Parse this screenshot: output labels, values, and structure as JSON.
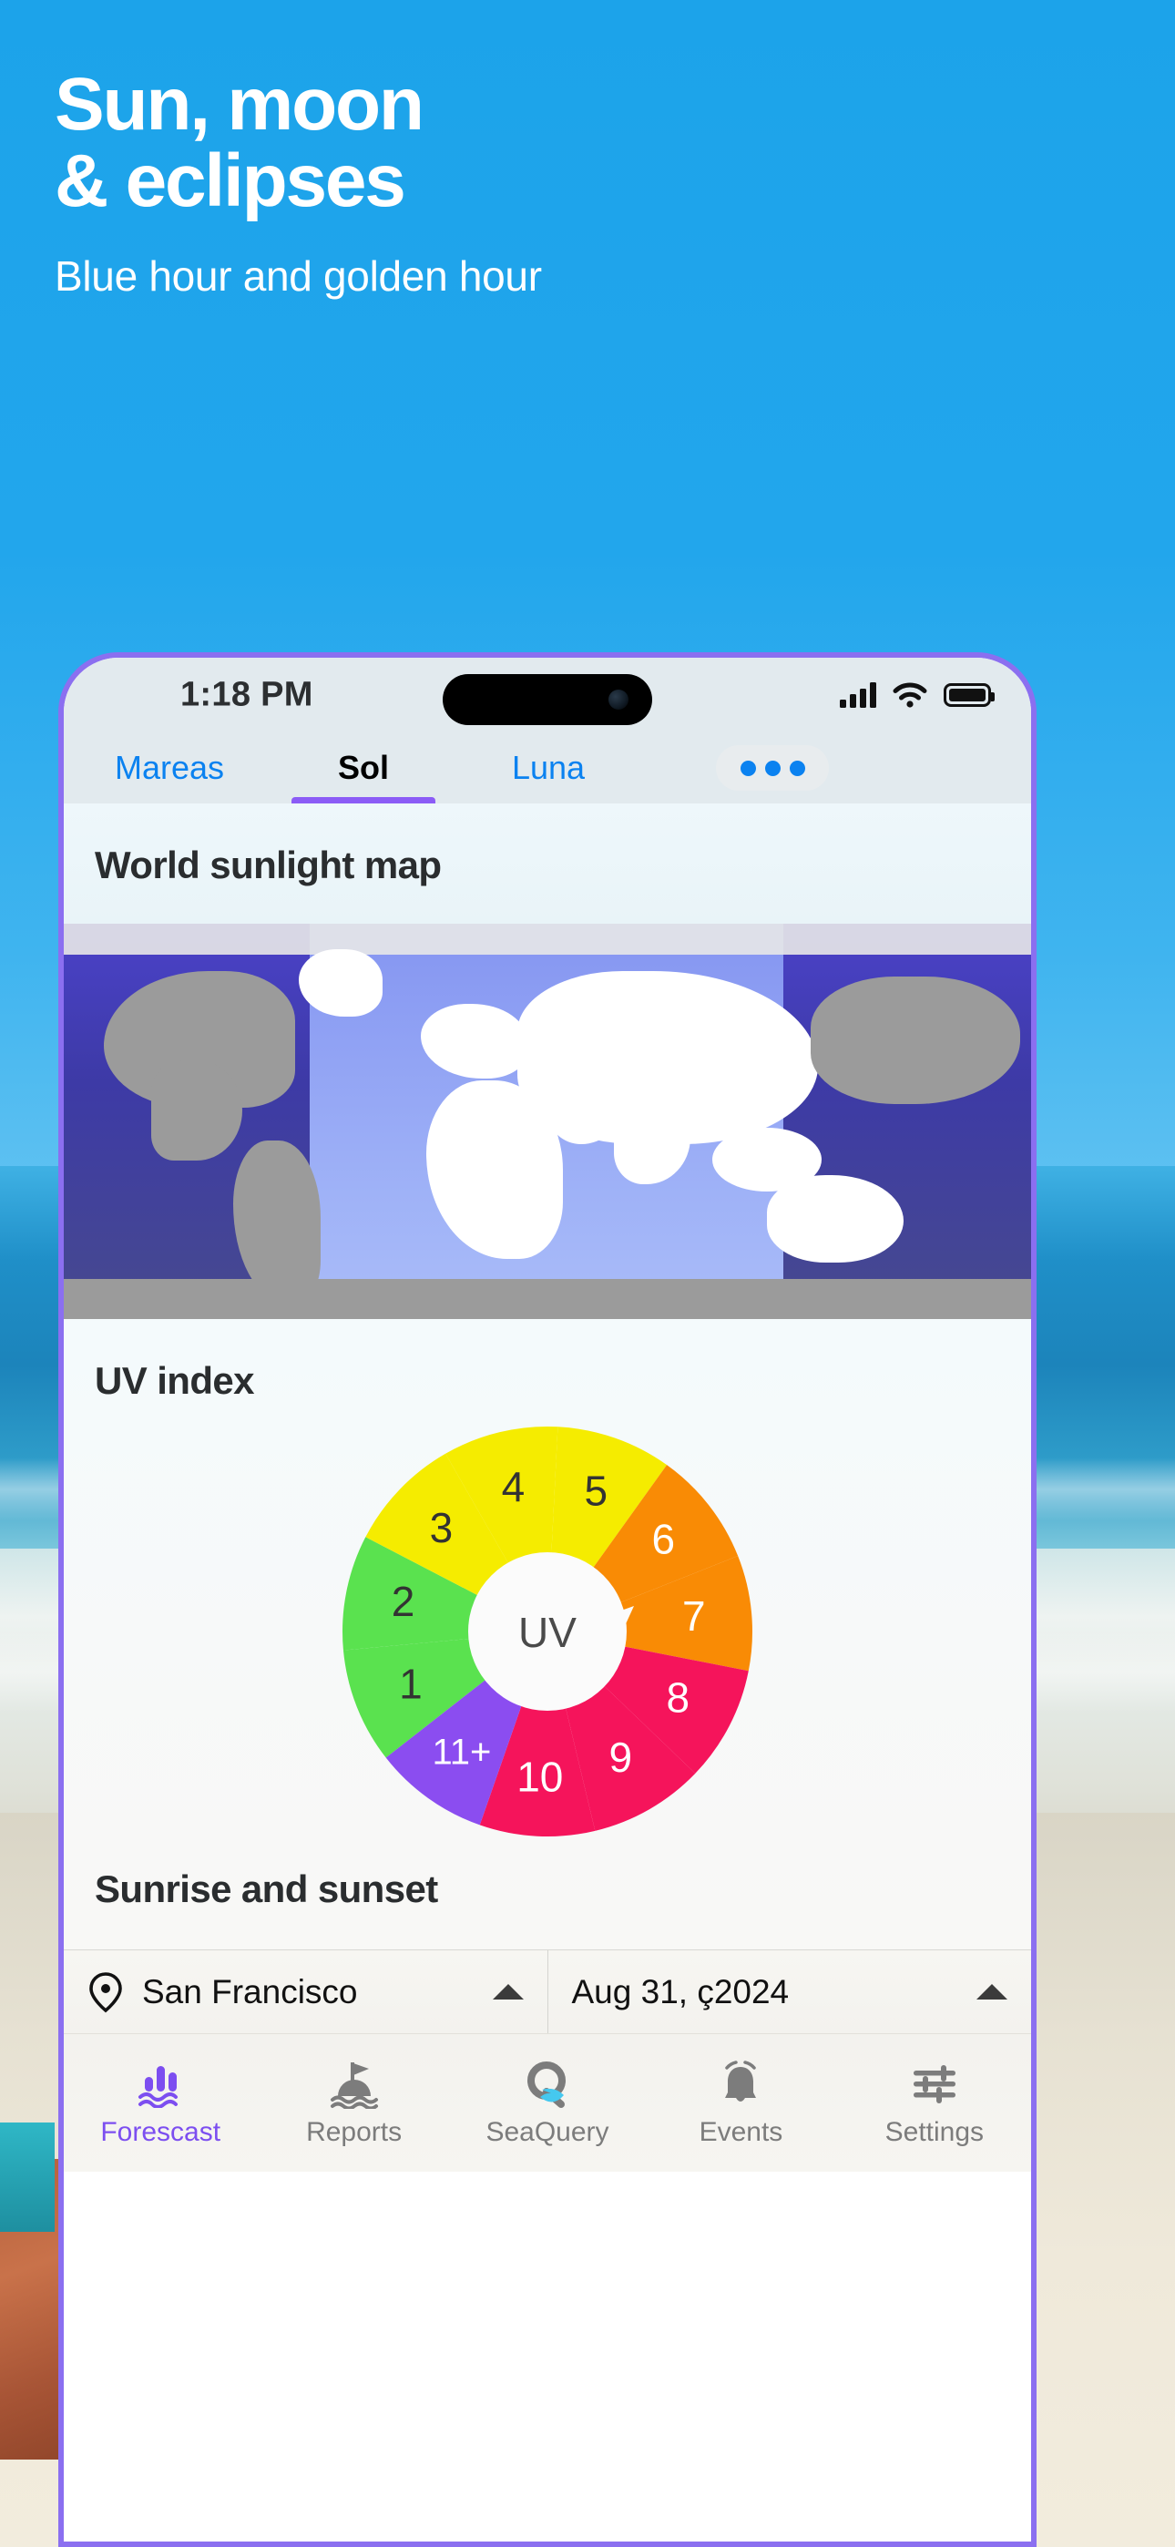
{
  "hero": {
    "title_line1": "Sun, moon",
    "title_line2": "& eclipses",
    "subtitle": "Blue hour and golden hour"
  },
  "colors": {
    "background_blue": "#1ca3ea",
    "phone_border_purple": "#8b6ff0",
    "tab_link_blue": "#0b82f0",
    "tab_active_underline": "#8b5cf6",
    "nav_active_purple": "#7c4ef0",
    "nav_inactive_gray": "#7c7c7c",
    "seaquery_cyan": "#45c8ef"
  },
  "statusbar": {
    "time": "1:18 PM",
    "signal_icon": "cellular-bars-icon",
    "wifi_icon": "wifi-icon",
    "battery_icon": "battery-full-icon",
    "dynamic_island": "dynamic-island"
  },
  "tabs": {
    "items": [
      {
        "label": "Mareas",
        "active": false
      },
      {
        "label": "Sol",
        "active": true
      },
      {
        "label": "Luna",
        "active": false
      }
    ],
    "more_label": "•••"
  },
  "sections": {
    "world_map_title": "World sunlight map",
    "uv_title": "UV index",
    "sunrise_title": "Sunrise and sunset"
  },
  "uv_wheel": {
    "center_label": "UV",
    "segments": [
      {
        "value": "1",
        "color": "#5ae24f",
        "text_color": "#333333"
      },
      {
        "value": "2",
        "color": "#5ae24f",
        "text_color": "#333333"
      },
      {
        "value": "3",
        "color": "#f5ec00",
        "text_color": "#333333"
      },
      {
        "value": "4",
        "color": "#f5ec00",
        "text_color": "#333333"
      },
      {
        "value": "5",
        "color": "#f5ec00",
        "text_color": "#333333"
      },
      {
        "value": "6",
        "color": "#f98b05",
        "text_color": "#ffffff"
      },
      {
        "value": "7",
        "color": "#f98b05",
        "text_color": "#ffffff"
      },
      {
        "value": "8",
        "color": "#f5145b",
        "text_color": "#ffffff"
      },
      {
        "value": "9",
        "color": "#f5145b",
        "text_color": "#ffffff"
      },
      {
        "value": "10",
        "color": "#f5145b",
        "text_color": "#ffffff"
      },
      {
        "value": "11+",
        "color": "#8b4df0",
        "text_color": "#ffffff"
      }
    ]
  },
  "location_row": {
    "pin_icon": "location-pin-icon",
    "location": "San Francisco",
    "date": "Aug 31, ç2024",
    "location_caret": "caret-up-icon",
    "date_caret": "caret-up-icon"
  },
  "bottom_nav": {
    "items": [
      {
        "label": "Forescast",
        "icon": "tide-bars-waves-icon",
        "active": true
      },
      {
        "label": "Reports",
        "icon": "buoy-flag-icon",
        "active": false
      },
      {
        "label": "SeaQuery",
        "icon": "q-wave-icon",
        "active": false
      },
      {
        "label": "Events",
        "icon": "bell-icon",
        "active": false
      },
      {
        "label": "Settings",
        "icon": "sliders-icon",
        "active": false
      }
    ]
  }
}
